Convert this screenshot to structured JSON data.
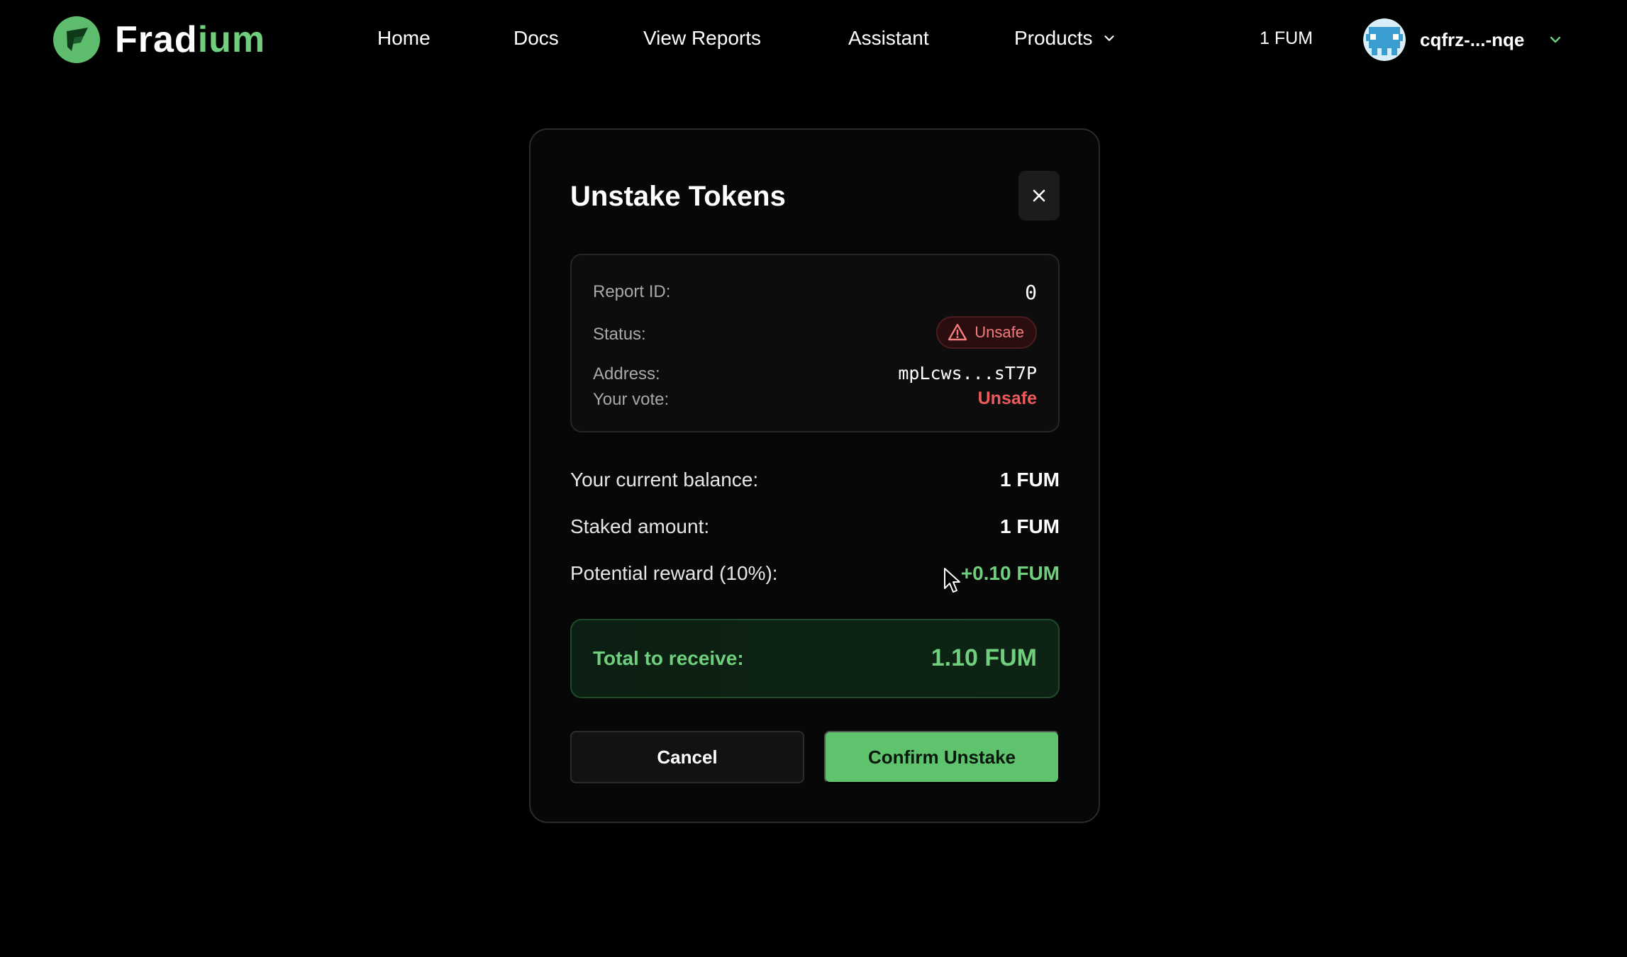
{
  "nav": {
    "logo_main": "Frad",
    "logo_accent": "ium",
    "links": [
      "Home",
      "Docs",
      "View Reports",
      "Assistant"
    ],
    "products_label": "Products",
    "balance": "1 FUM",
    "account_name": "cqfrz-...-nqe"
  },
  "modal": {
    "title": "Unstake Tokens",
    "report": {
      "report_id_label": "Report ID:",
      "report_id_value": "0",
      "status_label": "Status:",
      "status_value": "Unsafe",
      "address_label": "Address:",
      "address_value": "mpLcws...sT7P",
      "vote_label": "Your vote:",
      "vote_value": "Unsafe"
    },
    "summary": {
      "balance_label": "Your current balance:",
      "balance_value": "1 FUM",
      "staked_label": "Staked amount:",
      "staked_value": "1 FUM",
      "reward_label": "Potential reward (10%):",
      "reward_value": "+0.10 FUM"
    },
    "total": {
      "label": "Total to receive:",
      "value": "1.10 FUM"
    },
    "buttons": {
      "cancel": "Cancel",
      "confirm": "Confirm Unstake"
    }
  },
  "colors": {
    "background": "#000000",
    "accent_green": "#6fcf7d",
    "confirm_button": "#5fc36e",
    "unsafe_red": "#ef5a5a"
  },
  "icons": [
    "fradium-logo-icon",
    "chevron-down-icon",
    "avatar-icon",
    "close-icon",
    "warning-triangle-icon",
    "cursor-icon"
  ]
}
